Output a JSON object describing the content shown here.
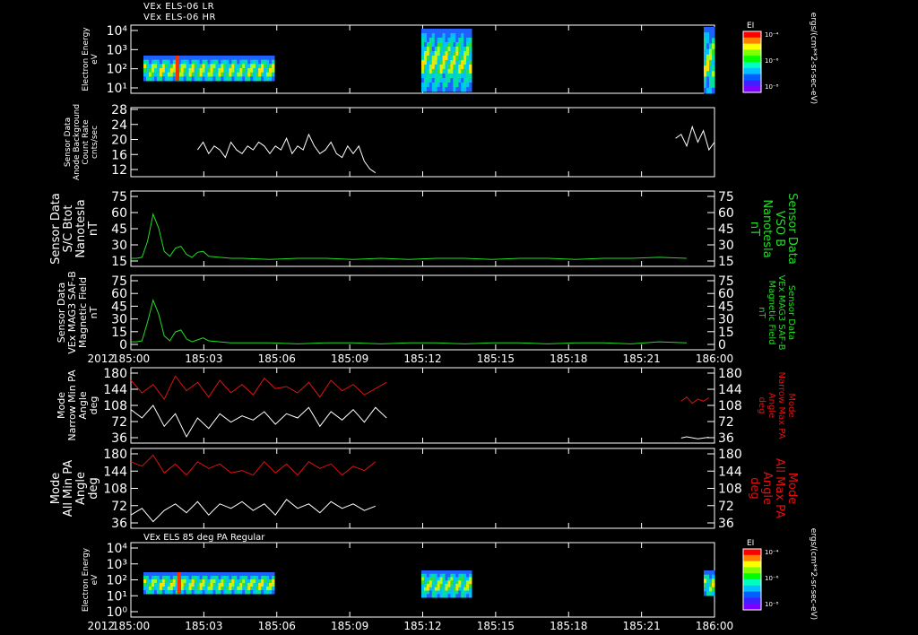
{
  "header": {
    "line1": "VEx ELS-06 LR",
    "line2": "VEx ELS-06 HR",
    "line3": "VEx ELS 85 deg PA Regular"
  },
  "colorbar": {
    "title": "EI",
    "unit": "ergs/(cm**2-sr-sec-eV)",
    "ticks": [
      "10⁻⁴",
      "10⁻⁶",
      "10⁻⁸"
    ]
  },
  "time_axis": {
    "year_label": "2012",
    "ticks": [
      "185:00",
      "185:03",
      "185:06",
      "185:09",
      "185:12",
      "185:15",
      "185:18",
      "185:21",
      "186:00"
    ]
  },
  "colors": {
    "green": "#22dd22",
    "red": "#dd1111",
    "white": "#ffffff"
  },
  "panels": [
    {
      "id": "energy1",
      "ylabel": [
        "Electron Energy",
        "eV"
      ],
      "ytick_labels": [
        "10⁴",
        "10³",
        "10²",
        "10¹"
      ]
    },
    {
      "id": "sensor",
      "ylabel": [
        "Sensor Data",
        "Anode Background",
        "Count Rate",
        "cnts/sec"
      ],
      "ytick_labels": [
        "28",
        "24",
        "20",
        "16",
        "12"
      ]
    },
    {
      "id": "btot",
      "ylabel": [
        "Sensor Data",
        "S/C Btot",
        "Nanotesla",
        "nT"
      ],
      "right_label": [
        "Sensor Data",
        "VSO B",
        "Nanotesla",
        "nT"
      ],
      "ytick_labels": [
        "75",
        "60",
        "45",
        "30",
        "15"
      ]
    },
    {
      "id": "mag",
      "ylabel": [
        "Sensor Data",
        "VEx MAG3 SAF-B",
        "Magnetic Field",
        "nT"
      ],
      "right_label": [
        "Sensor Data",
        "VEx MAG3 SAF-B",
        "Magnetic Field",
        "nT"
      ],
      "ytick_labels": [
        "75",
        "60",
        "45",
        "30",
        "15",
        "0"
      ]
    },
    {
      "id": "narrow",
      "ylabel": [
        "Mode",
        "Narrow Min PA",
        "Angle",
        "deg"
      ],
      "right_label": [
        "Mode",
        "Narrow Max PA",
        "Angle",
        "deg"
      ],
      "ytick_labels": [
        "180",
        "144",
        "108",
        "72",
        "36"
      ]
    },
    {
      "id": "all",
      "ylabel": [
        "Mode",
        "All Min PA",
        "Angle",
        "deg"
      ],
      "right_label": [
        "Mode",
        "All Max PA",
        "Angle",
        "deg"
      ],
      "ytick_labels": [
        "180",
        "144",
        "108",
        "72",
        "36"
      ]
    },
    {
      "id": "energy2",
      "ylabel": [
        "Electron Energy",
        "eV"
      ],
      "ytick_labels": [
        "10⁴",
        "10³",
        "10²",
        "10¹",
        "10⁰"
      ]
    }
  ],
  "chart_data": [
    {
      "type": "heatmap",
      "title": "VEx ELS-06 LR / VEx ELS-06 HR",
      "ylabel": "Electron Energy eV",
      "y_scale": "log",
      "ylim": [
        3,
        20000
      ],
      "x_range": [
        "185:00",
        "186:00"
      ],
      "data_intervals": [
        [
          "185:00",
          "185:05"
        ],
        [
          "185:11",
          "185:13"
        ],
        [
          "185:59",
          "186:00"
        ]
      ]
    },
    {
      "type": "line",
      "ylabel": "Sensor Data Anode Background Count Rate cnts/sec",
      "ylim": [
        10,
        28
      ],
      "series": [
        {
          "x": [
            185.6,
            185.65,
            185.7,
            185.75,
            185.8,
            185.85,
            185.9,
            185.95,
            186.0,
            186.05,
            186.1,
            186.15,
            186.2,
            186.25,
            186.3,
            186.35,
            186.4,
            186.45,
            186.5,
            186.55,
            186.6,
            186.65,
            186.7,
            186.75,
            186.8,
            186.85,
            186.9,
            186.95,
            187.0,
            187.05,
            187.1,
            187.15,
            187.2
          ],
          "y": [
            17,
            19,
            16,
            18,
            17,
            15,
            19,
            17,
            16,
            18,
            17,
            19,
            18,
            16,
            18,
            17,
            20,
            16,
            18,
            17,
            21,
            18,
            16,
            17,
            19,
            16,
            15,
            18,
            16,
            18,
            14,
            12,
            11
          ]
        },
        {
          "x": [
            189.9,
            189.95,
            190.0,
            190.05,
            190.1,
            190.15,
            190.2,
            190.25
          ],
          "y": [
            20,
            21,
            18,
            23,
            19,
            22,
            17,
            19
          ]
        }
      ]
    },
    {
      "type": "line",
      "ylabel": "Sensor Data S/C Btot Nanotesla nT",
      "ylim": [
        0,
        75
      ],
      "series": [
        {
          "name": "Sensor Data VSO B Nanotesla nT",
          "x": [
            185.0,
            185.05,
            185.1,
            185.15,
            185.2,
            185.25,
            185.3,
            185.35,
            185.4,
            185.45,
            185.5,
            185.55,
            185.6,
            185.65,
            185.7,
            185.8,
            185.9,
            186.0,
            186.25,
            186.5,
            186.75,
            187.0,
            187.25,
            187.5,
            187.75,
            188.0,
            188.25,
            188.5,
            188.75,
            189.0,
            189.25,
            189.5,
            189.75,
            190.0
          ],
          "y": [
            8,
            8,
            9,
            25,
            52,
            38,
            15,
            10,
            18,
            20,
            12,
            9,
            14,
            15,
            10,
            9,
            8,
            8,
            7,
            8,
            8,
            7,
            8,
            7,
            8,
            8,
            7,
            8,
            8,
            7,
            8,
            8,
            9,
            8
          ]
        }
      ]
    },
    {
      "type": "line",
      "ylabel": "Sensor Data VEx MAG3 SAF-B Magnetic Field nT",
      "ylim": [
        0,
        75
      ],
      "series": [
        {
          "name": "Sensor Data VEx MAG3 SAF-B Magnetic Field nT",
          "x": [
            185.0,
            185.05,
            185.1,
            185.15,
            185.2,
            185.25,
            185.3,
            185.35,
            185.4,
            185.45,
            185.5,
            185.55,
            185.6,
            185.65,
            185.7,
            185.8,
            185.9,
            186.0,
            186.25,
            186.5,
            186.75,
            187.0,
            187.25,
            187.5,
            187.75,
            188.0,
            188.25,
            188.5,
            188.75,
            189.0,
            189.25,
            189.5,
            189.75,
            190.0
          ],
          "y": [
            8,
            8,
            9,
            28,
            50,
            36,
            14,
            9,
            18,
            20,
            11,
            8,
            10,
            12,
            9,
            8,
            7,
            7,
            7,
            6,
            7,
            7,
            6,
            7,
            7,
            6,
            7,
            7,
            6,
            7,
            7,
            6,
            8,
            7
          ]
        }
      ]
    },
    {
      "type": "line",
      "ylabel": "Mode Narrow Min PA Angle deg",
      "ylim": [
        0,
        180
      ],
      "series": [
        {
          "name": "Mode Narrow Max PA Angle deg",
          "x": [
            185.0,
            185.1,
            185.2,
            185.3,
            185.4,
            185.5,
            185.6,
            185.7,
            185.8,
            185.9,
            186.0,
            186.1,
            186.2,
            186.3,
            186.4,
            186.5,
            186.6,
            186.7,
            186.8,
            186.9,
            187.0,
            187.1,
            187.2,
            187.3,
            187.4,
            187.5,
            187.6,
            187.7,
            187.8,
            187.9,
            188.0,
            188.1,
            188.2,
            188.3,
            188.4,
            188.5,
            188.6,
            188.7,
            188.8,
            188.9,
            189.0,
            189.1,
            189.2,
            189.3,
            189.4,
            189.5,
            189.6,
            189.7,
            189.8,
            189.9,
            190.0
          ],
          "y": [
            150,
            120,
            140,
            105,
            160,
            125,
            145,
            110,
            150,
            120,
            140,
            115,
            155,
            130,
            135,
            120,
            145,
            110,
            150,
            125,
            140,
            115,
            130,
            145,
            null,
            null,
            null,
            null,
            null,
            null,
            null,
            null,
            null,
            null,
            null,
            null,
            null,
            null,
            null,
            null,
            null,
            null,
            null,
            null,
            null,
            null,
            null,
            null,
            null,
            null,
            null
          ]
        },
        {
          "name": "Mode Narrow Min PA",
          "x": [
            185.0,
            185.1,
            185.2,
            185.3,
            185.4,
            185.5,
            185.6,
            185.7,
            185.8,
            185.9,
            186.0,
            186.1,
            186.2,
            186.3,
            186.4,
            186.5,
            186.6,
            186.7,
            186.8,
            186.9,
            187.0,
            187.1,
            187.2,
            187.3
          ],
          "y": [
            80,
            60,
            90,
            40,
            70,
            15,
            60,
            35,
            70,
            50,
            65,
            55,
            75,
            45,
            70,
            60,
            85,
            40,
            75,
            55,
            80,
            50,
            85,
            60
          ]
        }
      ]
    },
    {
      "type": "line",
      "ylabel": "Mode All Min PA Angle deg",
      "ylim": [
        0,
        180
      ],
      "series": [
        {
          "name": "Mode All Max PA Angle deg",
          "x": [
            185.0,
            186.0,
            187.0
          ],
          "y": [
            150,
            140,
            145
          ]
        },
        {
          "name": "Mode All Min PA",
          "x": [
            185.0,
            186.0,
            187.0
          ],
          "y": [
            20,
            35,
            40
          ]
        }
      ]
    },
    {
      "type": "heatmap",
      "title": "VEx ELS 85 deg PA Regular",
      "ylabel": "Electron Energy eV",
      "y_scale": "log",
      "ylim": [
        1,
        20000
      ],
      "x_range": [
        "185:00",
        "186:00"
      ],
      "data_intervals": [
        [
          "185:00",
          "185:05"
        ],
        [
          "185:11",
          "185:13"
        ],
        [
          "185:59",
          "186:00"
        ]
      ]
    }
  ]
}
